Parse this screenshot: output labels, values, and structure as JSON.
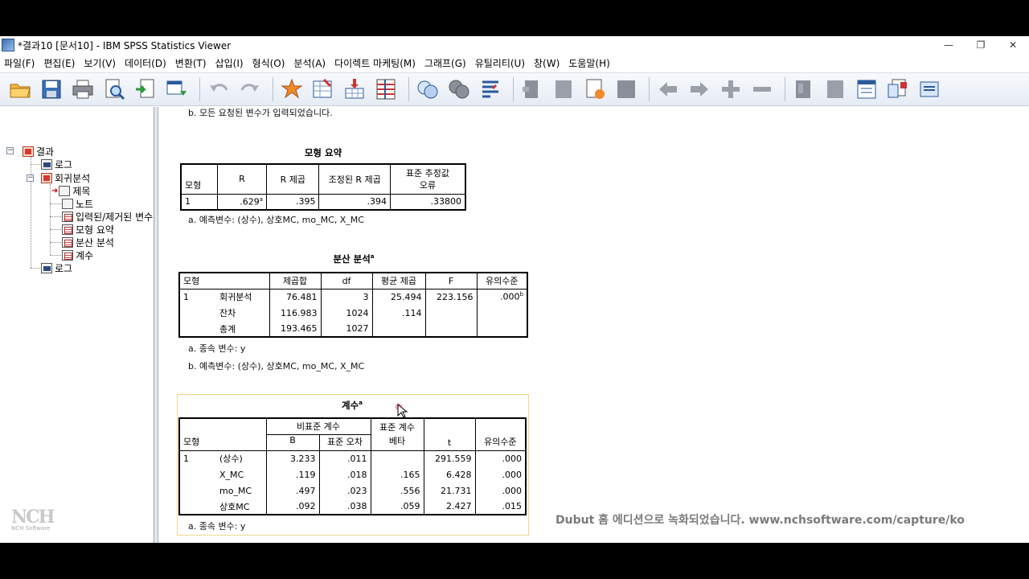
{
  "window": {
    "title": "*결과10 [문서10] - IBM SPSS Statistics Viewer",
    "minimize": "—",
    "restore": "❐",
    "close": "✕"
  },
  "menu": [
    "파일(F)",
    "편집(E)",
    "보기(V)",
    "데이터(D)",
    "변환(T)",
    "삽입(I)",
    "형식(O)",
    "분석(A)",
    "다이렉트 마케팅(M)",
    "그래프(G)",
    "유틸리티(U)",
    "창(W)",
    "도움말(H)"
  ],
  "toolbar_icons": [
    "open-icon",
    "save-icon",
    "print-icon",
    "print-preview-icon",
    "export-icon",
    "recall-dialog-icon",
    "undo-icon",
    "redo-icon",
    "goto-data-icon",
    "goto-case-icon",
    "goto-variable-icon",
    "variables-icon",
    "use-sets-icon",
    "show-all-icon",
    "spell-icon",
    "designate-window-icon",
    "promote-icon",
    "demote-icon",
    "expand-icon",
    "collapse-icon",
    "show-icon",
    "hide-icon",
    "insert-heading-icon",
    "insert-title-icon",
    "insert-text-icon",
    "insert-new-icon"
  ],
  "outline": {
    "root": "결과",
    "log1": "로그",
    "regression": "회귀분석",
    "children": [
      "제목",
      "노트",
      "입력된/제거된 변수",
      "모형 요약",
      "분산 분석",
      "계수"
    ],
    "log2": "로그"
  },
  "top_note": "b. 모든 요청된 변수가 입력되었습니다.",
  "model_summary": {
    "title": "모형 요약",
    "headers": [
      "모형",
      "R",
      "R 제곱",
      "조정된 R 제곱",
      "표준 추정값",
      "오류"
    ],
    "row": [
      "1",
      ".629",
      "a",
      ".395",
      ".394",
      ".33800"
    ],
    "note": "a. 예측변수: (상수), 상호MC, mo_MC, X_MC"
  },
  "anova": {
    "title": "분산 분석",
    "title_sup": "a",
    "headers": [
      "모형",
      "제곱합",
      "df",
      "평균 제곱",
      "F",
      "유의수준"
    ],
    "rows": [
      [
        "1",
        "회귀분석",
        "76.481",
        "3",
        "25.494",
        "223.156",
        ".000",
        "b"
      ],
      [
        "",
        "잔차",
        "116.983",
        "1024",
        ".114",
        "",
        "",
        ""
      ],
      [
        "",
        "총계",
        "193.465",
        "1027",
        "",
        "",
        "",
        ""
      ]
    ],
    "note_a": "a. 종속 변수: y",
    "note_b": "b. 예측변수: (상수), 상호MC, mo_MC, X_MC"
  },
  "coefficients": {
    "title": "계수",
    "title_sup": "a",
    "group1": "비표준 계수",
    "group2": "표준 계수",
    "headers": [
      "모형",
      "B",
      "표준 오차",
      "베타",
      "t",
      "유의수준"
    ],
    "rows": [
      [
        "1",
        "(상수)",
        "3.233",
        ".011",
        "",
        "291.559",
        ".000"
      ],
      [
        "",
        "X_MC",
        ".119",
        ".018",
        ".165",
        "6.428",
        ".000"
      ],
      [
        "",
        "mo_MC",
        ".497",
        ".023",
        ".556",
        "21.731",
        ".000"
      ],
      [
        "",
        "상호MC",
        ".092",
        ".038",
        ".059",
        "2.427",
        ".015"
      ]
    ],
    "note": "a. 종속 변수: y"
  },
  "watermark": "Dubut 홈 에디션으로 녹화되었습니다. www.nchsoftware.com/capture/ko",
  "nch_logo": "NCH",
  "nch_sub": "NCH Software"
}
